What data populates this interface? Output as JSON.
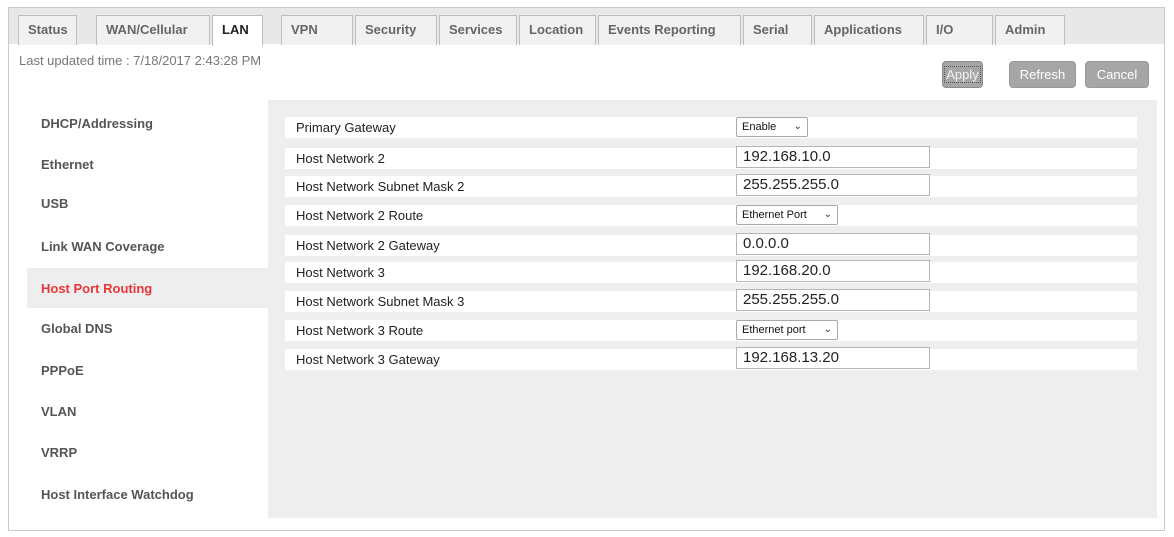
{
  "tabs": [
    {
      "label": "Status"
    },
    {
      "label": "WAN/Cellular"
    },
    {
      "label": "LAN"
    },
    {
      "label": "VPN"
    },
    {
      "label": "Security"
    },
    {
      "label": "Services"
    },
    {
      "label": "Location"
    },
    {
      "label": "Events Reporting"
    },
    {
      "label": "Serial"
    },
    {
      "label": "Applications"
    },
    {
      "label": "I/O"
    },
    {
      "label": "Admin"
    }
  ],
  "active_tab": "LAN",
  "header": {
    "last_updated": "Last updated time : 7/18/2017 2:43:28 PM",
    "apply_label": "Apply",
    "refresh_label": "Refresh",
    "cancel_label": "Cancel"
  },
  "sidebar": {
    "items": [
      {
        "label": "DHCP/Addressing"
      },
      {
        "label": "Ethernet"
      },
      {
        "label": "USB"
      },
      {
        "label": "Link WAN Coverage"
      },
      {
        "label": "Host Port Routing"
      },
      {
        "label": "Global DNS"
      },
      {
        "label": "PPPoE"
      },
      {
        "label": "VLAN"
      },
      {
        "label": "VRRP"
      },
      {
        "label": "Host Interface Watchdog"
      }
    ],
    "active_item": "Host Port Routing",
    "active_color": "#e8373a"
  },
  "settings": {
    "rows": [
      {
        "label": "Primary Gateway",
        "type": "select",
        "value": "Enable"
      },
      {
        "label": "Host Network 2",
        "type": "input",
        "value": "192.168.10.0"
      },
      {
        "label": "Host Network Subnet Mask 2",
        "type": "input",
        "value": "255.255.255.0"
      },
      {
        "label": "Host Network 2 Route",
        "type": "select",
        "value": "Ethernet Port"
      },
      {
        "label": "Host Network 2 Gateway",
        "type": "input",
        "value": "0.0.0.0"
      },
      {
        "label": "Host Network 3",
        "type": "input",
        "value": "192.168.20.0"
      },
      {
        "label": "Host Network Subnet Mask 3",
        "type": "input",
        "value": "255.255.255.0"
      },
      {
        "label": "Host Network 3 Route",
        "type": "select",
        "value": "Ethernet port"
      },
      {
        "label": "Host Network 3 Gateway",
        "type": "input",
        "value": "192.168.13.20"
      }
    ]
  },
  "icons": {
    "dropdown": "chevron-down-icon"
  }
}
